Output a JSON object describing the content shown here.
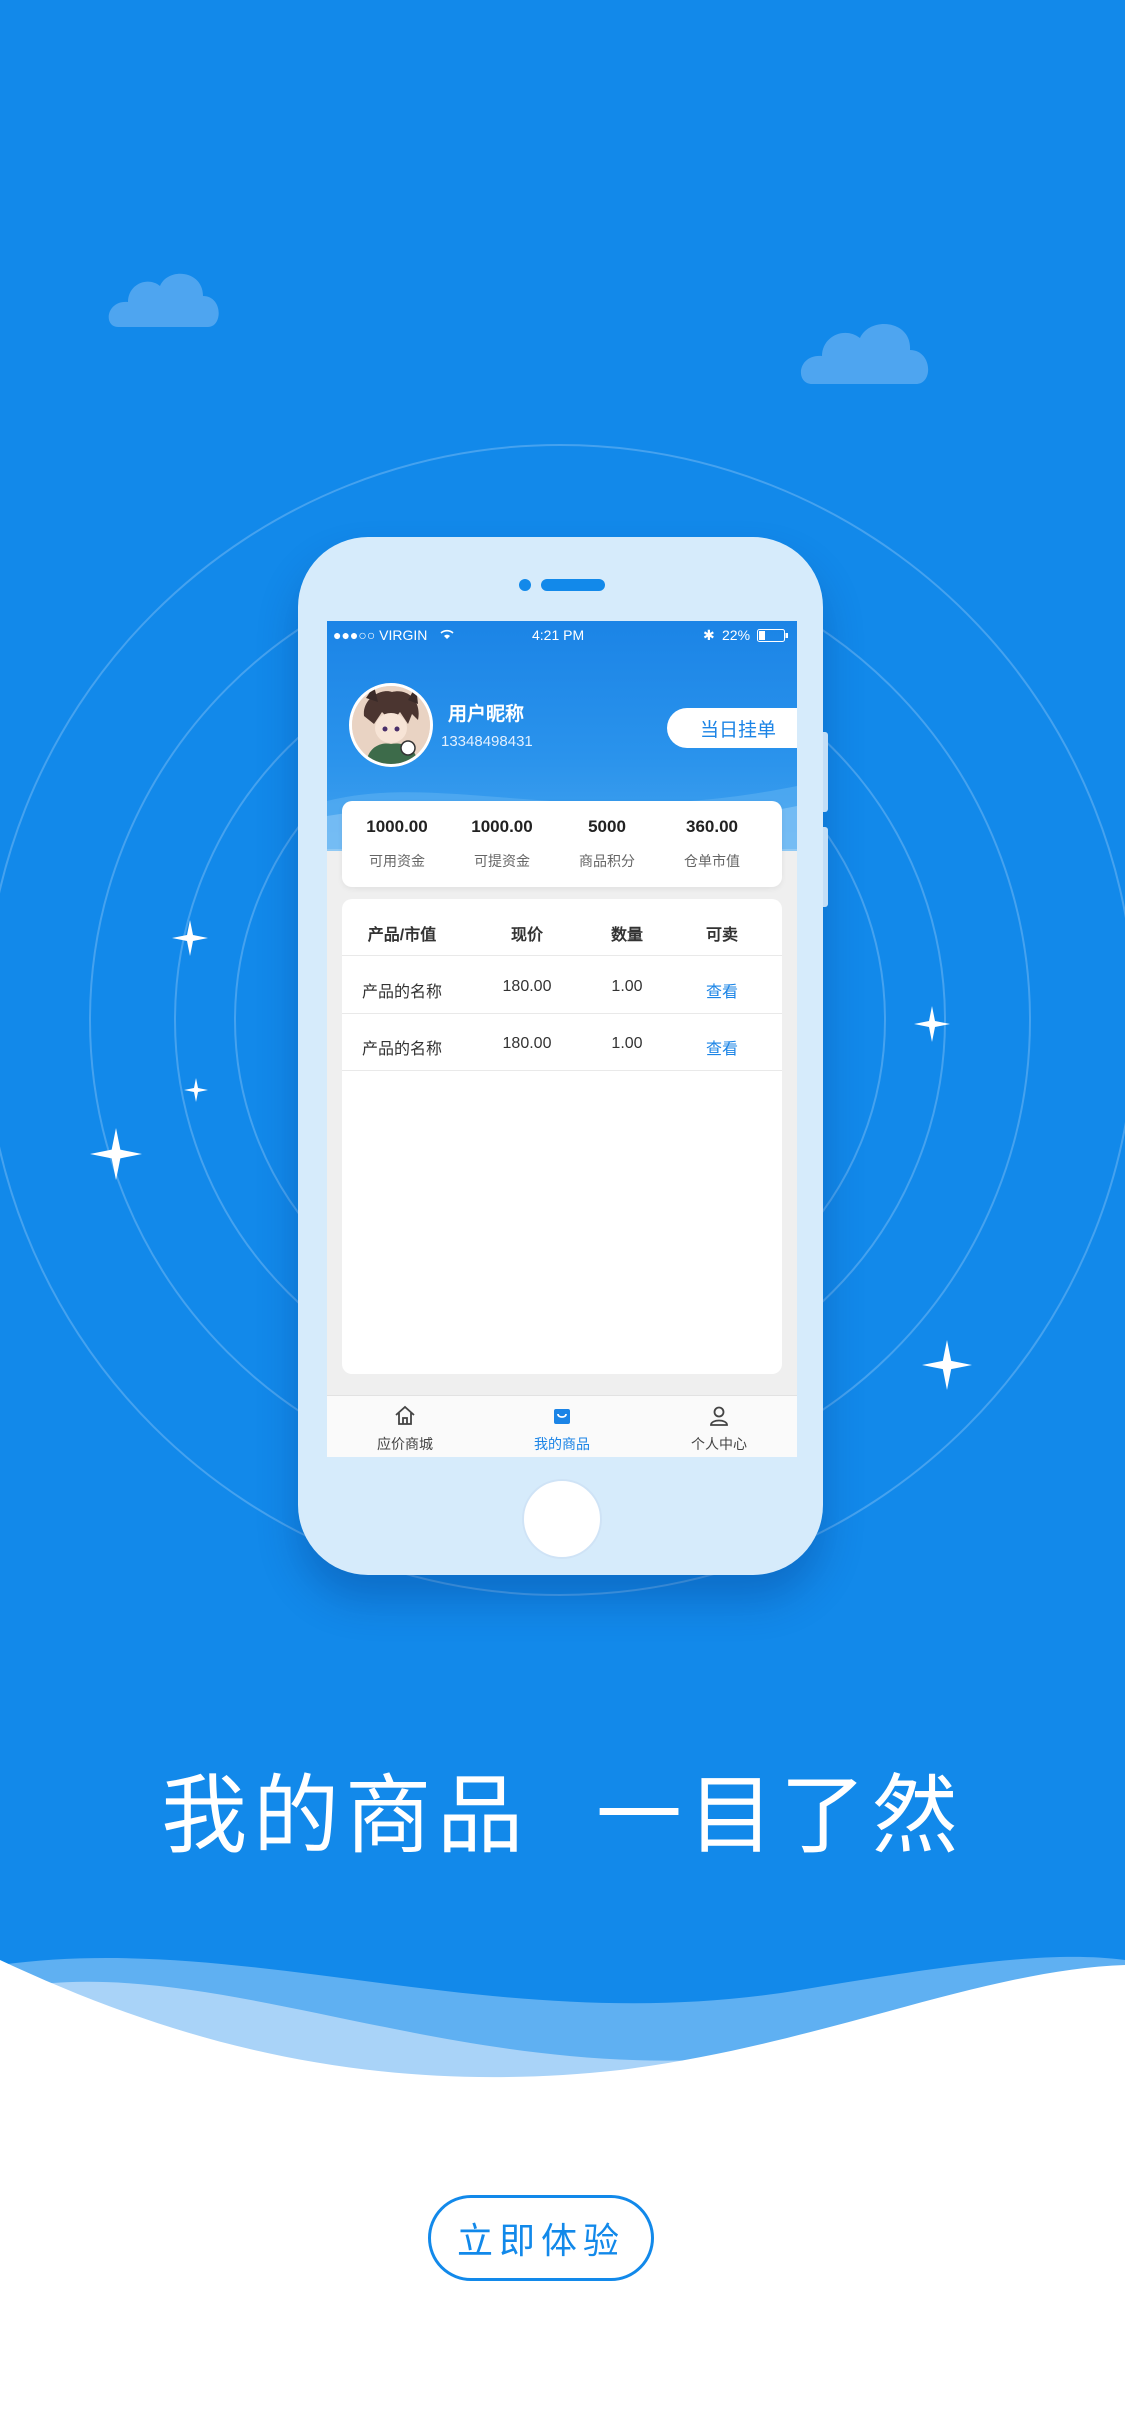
{
  "colors": {
    "primary": "#1289ea",
    "header_blue": "#1b84e6",
    "link": "#1b84e6",
    "white": "#ffffff"
  },
  "status_bar": {
    "carrier": "●●●○○ VIRGIN",
    "time": "4:21 PM",
    "battery": "22%"
  },
  "profile": {
    "nickname": "用户昵称",
    "phone": "13348498431",
    "order_button": "当日挂单"
  },
  "stats": [
    {
      "value": "1000.00",
      "label": "可用资金"
    },
    {
      "value": "1000.00",
      "label": "可提资金"
    },
    {
      "value": "5000",
      "label": "商品积分"
    },
    {
      "value": "360.00",
      "label": "仓单市值"
    }
  ],
  "table": {
    "headers": [
      "产品/市值",
      "现价",
      "数量",
      "可卖"
    ],
    "rows": [
      [
        "产品的名称",
        "180.00",
        "1.00",
        "查看"
      ],
      [
        "产品的名称",
        "180.00",
        "1.00",
        "查看"
      ]
    ]
  },
  "tabbar": [
    {
      "label": "应价商城",
      "icon": "home-icon"
    },
    {
      "label": "我的商品",
      "icon": "shopping-bag-icon",
      "active": true
    },
    {
      "label": "个人中心",
      "icon": "user-icon"
    }
  ],
  "headline": "我的商品  一目了然",
  "cta": "立即体验"
}
